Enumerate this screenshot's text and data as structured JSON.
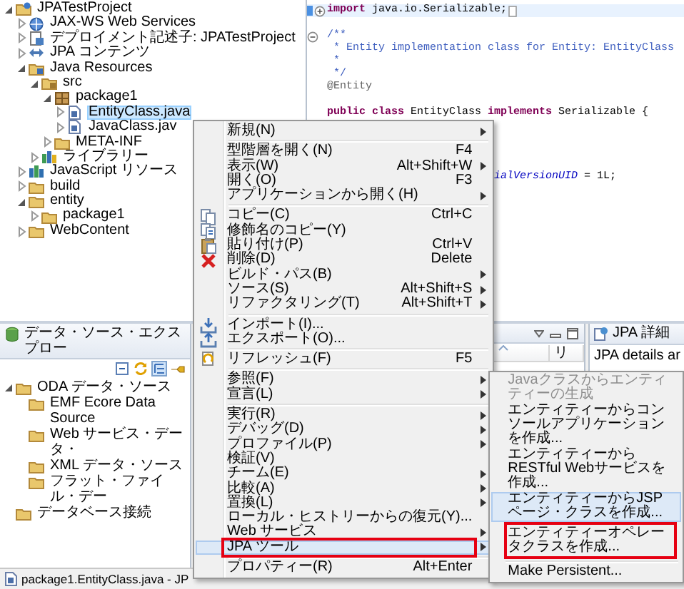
{
  "project_explorer": {
    "tree": [
      {
        "label": "JPATestProject",
        "kind": "project",
        "expanded": true,
        "selected": false,
        "children": [
          {
            "label": "JAX-WS Web Services",
            "kind": "webservice",
            "expanded": false,
            "selected": false
          },
          {
            "label": "デプロイメント記述子: JPATestProject",
            "kind": "descriptor",
            "expanded": false,
            "selected": false
          },
          {
            "label": "JPA コンテンツ",
            "kind": "jpa",
            "expanded": false,
            "selected": false
          },
          {
            "label": "Java Resources",
            "kind": "resources",
            "expanded": true,
            "selected": false,
            "children": [
              {
                "label": "src",
                "kind": "sourcefolder",
                "expanded": true,
                "selected": false,
                "children": [
                  {
                    "label": "package1",
                    "kind": "package",
                    "expanded": true,
                    "selected": false,
                    "children": [
                      {
                        "label": "EntityClass.java",
                        "kind": "file",
                        "expanded": false,
                        "selected": true
                      },
                      {
                        "label": "JavaClass.jav",
                        "kind": "file",
                        "expanded": false,
                        "selected": false
                      }
                    ]
                  },
                  {
                    "label": "META-INF",
                    "kind": "folder",
                    "expanded": false,
                    "selected": false
                  }
                ]
              },
              {
                "label": "ライブラリー",
                "kind": "library",
                "expanded": false,
                "selected": false
              }
            ]
          },
          {
            "label": "JavaScript リソース",
            "kind": "script",
            "expanded": false,
            "selected": false
          },
          {
            "label": "build",
            "kind": "folder",
            "expanded": false,
            "selected": false
          },
          {
            "label": "entity",
            "kind": "folder",
            "expanded": true,
            "selected": false,
            "children": [
              {
                "label": "package1",
                "kind": "folder",
                "expanded": false,
                "selected": false
              }
            ]
          },
          {
            "label": "WebContent",
            "kind": "folder",
            "expanded": false,
            "selected": false
          }
        ]
      }
    ]
  },
  "editor": {
    "lines": [
      {
        "kind": "code",
        "current": true,
        "collapsed": true,
        "segments": [
          {
            "text": "import",
            "kind": "keyword"
          },
          {
            "text": " java.io.Serializable;",
            "kind": "plain"
          }
        ]
      },
      {
        "kind": "blank"
      },
      {
        "kind": "code",
        "current": false,
        "collapsed": false,
        "segments": [
          {
            "text": "/**",
            "kind": "comment"
          }
        ]
      },
      {
        "kind": "code",
        "current": false,
        "segments": [
          {
            "text": " * Entity implementation class for Entity: EntityClass",
            "kind": "comment"
          }
        ]
      },
      {
        "kind": "code",
        "current": false,
        "segments": [
          {
            "text": " *",
            "kind": "comment"
          }
        ]
      },
      {
        "kind": "code",
        "current": false,
        "segments": [
          {
            "text": " */",
            "kind": "comment"
          }
        ]
      },
      {
        "kind": "code",
        "current": false,
        "segments": [
          {
            "text": "@Entity",
            "kind": "annotation"
          }
        ]
      },
      {
        "kind": "blank"
      },
      {
        "kind": "code",
        "current": false,
        "segments": [
          {
            "text": "public class",
            "kind": "keyword"
          },
          {
            "text": " EntityClass ",
            "kind": "plain"
          },
          {
            "text": "implements",
            "kind": "keyword"
          },
          {
            "text": " Serializable {",
            "kind": "plain"
          }
        ]
      },
      {
        "kind": "blank"
      },
      {
        "kind": "blank"
      },
      {
        "kind": "blank"
      },
      {
        "kind": "blank"
      },
      {
        "kind": "covered",
        "current": false,
        "segments": [
          {
            "text": "ialVersionUID",
            "kind": "field"
          },
          {
            "text": " = 1L;",
            "kind": "plain"
          }
        ]
      }
    ]
  },
  "data_source_explorer": {
    "title": "データ・ソース・エクスプロー",
    "toolbar": [
      {
        "pressed": false
      },
      {
        "pressed": false
      },
      {
        "pressed": true
      },
      {
        "pressed": false
      }
    ],
    "tree": [
      {
        "label": "ODA データ・ソース",
        "expanded": true,
        "children": [
          {
            "label": "EMF Ecore Data Source"
          },
          {
            "label": "Web サービス・データ・"
          },
          {
            "label": "XML データ・ソース"
          },
          {
            "label": "フラット・ファイル・デー"
          }
        ]
      },
      {
        "label": "データベース接続"
      }
    ]
  },
  "table_panel": {
    "columns": [
      {
        "sorted": true
      },
      {
        "label": "リ"
      }
    ]
  },
  "details_panel": {
    "title": "JPA 詳細",
    "text": "JPA details ar"
  },
  "context_menu": {
    "items": [
      {
        "kind": "item",
        "label": "新規(N)",
        "submenu": true,
        "selected": false,
        "boxed": false
      },
      {
        "kind": "separator"
      },
      {
        "kind": "item",
        "label": "型階層を開く(N)",
        "shortcut": "F4",
        "submenu": false,
        "selected": false,
        "boxed": false
      },
      {
        "kind": "item",
        "label": "表示(W)",
        "shortcut": "Alt+Shift+W",
        "submenu": true,
        "selected": false,
        "boxed": false
      },
      {
        "kind": "item",
        "label": "開く(O)",
        "shortcut": "F3",
        "submenu": false,
        "selected": false,
        "boxed": false
      },
      {
        "kind": "item",
        "label": "アプリケーションから開く(H)",
        "submenu": true,
        "selected": false,
        "boxed": false
      },
      {
        "kind": "separator"
      },
      {
        "kind": "copy",
        "label": "コピー(C)",
        "shortcut": "Ctrl+C",
        "submenu": false,
        "selected": false,
        "boxed": false
      },
      {
        "kind": "qualified",
        "label": "修飾名のコピー(Y)",
        "submenu": false,
        "selected": false,
        "boxed": false
      },
      {
        "kind": "paste",
        "label": "貼り付け(P)",
        "shortcut": "Ctrl+V",
        "submenu": false,
        "selected": false,
        "boxed": false
      },
      {
        "kind": "delete",
        "label": "削除(D)",
        "shortcut": "Delete",
        "submenu": false,
        "selected": false,
        "boxed": false
      },
      {
        "kind": "item",
        "label": "ビルド・パス(B)",
        "submenu": true,
        "selected": false,
        "boxed": false
      },
      {
        "kind": "item",
        "label": "ソース(S)",
        "shortcut": "Alt+Shift+S",
        "submenu": true,
        "selected": false,
        "boxed": false
      },
      {
        "kind": "item",
        "label": "リファクタリング(T)",
        "shortcut": "Alt+Shift+T",
        "submenu": true,
        "selected": false,
        "boxed": false
      },
      {
        "kind": "separator"
      },
      {
        "kind": "import",
        "label": "インポート(I)...",
        "submenu": false,
        "selected": false,
        "boxed": false
      },
      {
        "kind": "export",
        "label": "エクスポート(O)...",
        "submenu": false,
        "selected": false,
        "boxed": false
      },
      {
        "kind": "separator"
      },
      {
        "kind": "refresh",
        "label": "リフレッシュ(F)",
        "shortcut": "F5",
        "submenu": false,
        "selected": false,
        "boxed": false
      },
      {
        "kind": "separator"
      },
      {
        "kind": "item",
        "label": "参照(F)",
        "submenu": true,
        "selected": false,
        "boxed": false
      },
      {
        "kind": "item",
        "label": "宣言(L)",
        "submenu": true,
        "selected": false,
        "boxed": false
      },
      {
        "kind": "separator"
      },
      {
        "kind": "item",
        "label": "実行(R)",
        "submenu": true,
        "selected": false,
        "boxed": false
      },
      {
        "kind": "item",
        "label": "デバッグ(D)",
        "submenu": true,
        "selected": false,
        "boxed": false
      },
      {
        "kind": "item",
        "label": "プロファイル(P)",
        "submenu": true,
        "selected": false,
        "boxed": false
      },
      {
        "kind": "item",
        "label": "検証(V)",
        "submenu": false,
        "selected": false,
        "boxed": false
      },
      {
        "kind": "item",
        "label": "チーム(E)",
        "submenu": true,
        "selected": false,
        "boxed": false
      },
      {
        "kind": "item",
        "label": "比較(A)",
        "submenu": true,
        "selected": false,
        "boxed": false
      },
      {
        "kind": "item",
        "label": "置換(L)",
        "submenu": true,
        "selected": false,
        "boxed": false
      },
      {
        "kind": "item",
        "label": "ローカル・ヒストリーからの復元(Y)...",
        "submenu": false,
        "selected": false,
        "boxed": false
      },
      {
        "kind": "item",
        "label": "Web サービス",
        "submenu": true,
        "selected": false,
        "boxed": false
      },
      {
        "kind": "item",
        "label": "JPA ツール",
        "submenu": true,
        "selected": true,
        "boxed": true
      },
      {
        "kind": "separator"
      },
      {
        "kind": "item",
        "label": "プロパティー(R)",
        "shortcut": "Alt+Enter",
        "submenu": false,
        "selected": false,
        "boxed": false
      }
    ]
  },
  "submenu": {
    "items": [
      {
        "kind": "item",
        "label": "Javaクラスからエンティティーの生成",
        "disabled": true,
        "selected": false,
        "boxed": false
      },
      {
        "kind": "item",
        "label": "エンティティーからコンソールアプリケーションを作成...",
        "disabled": false,
        "selected": false,
        "boxed": false
      },
      {
        "kind": "item",
        "label": "エンティティーからRESTful Webサービスを作成...",
        "disabled": false,
        "selected": false,
        "boxed": false
      },
      {
        "kind": "item",
        "label": "エンティティーからJSPページ・クラスを作成...",
        "disabled": false,
        "selected": true,
        "boxed": false
      },
      {
        "kind": "item",
        "label": "エンティティーオペレータクラスを作成...",
        "disabled": false,
        "selected": false,
        "boxed": true
      },
      {
        "kind": "separator"
      },
      {
        "kind": "item",
        "label": "Make Persistent...",
        "disabled": false,
        "selected": false,
        "boxed": false
      }
    ]
  },
  "status_bar": {
    "text": "package1.EntityClass.java - JP"
  }
}
